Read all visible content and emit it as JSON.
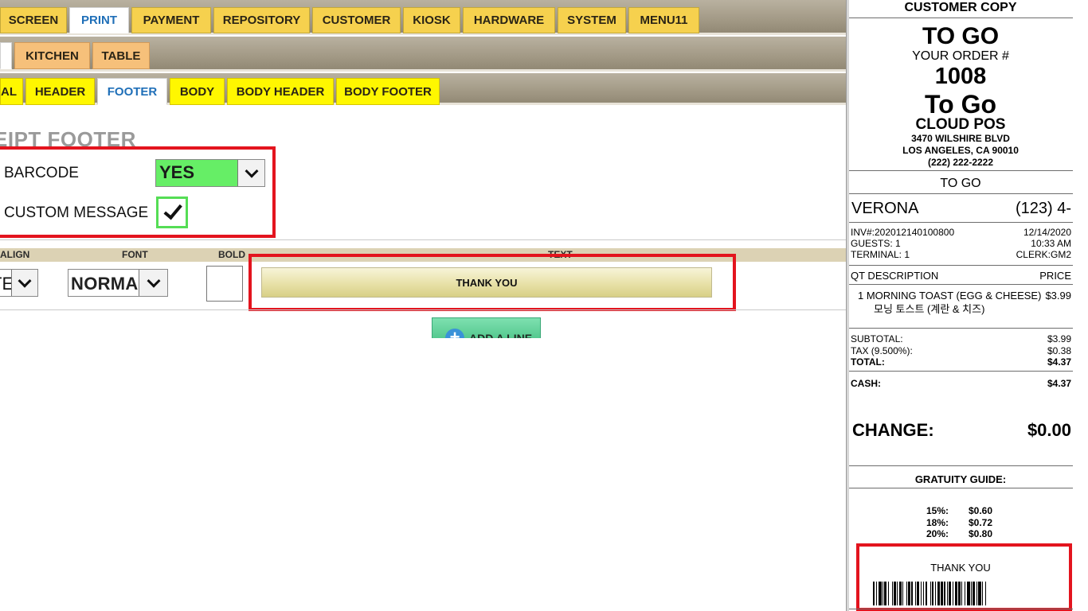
{
  "top_tabs": [
    {
      "label": "SCREEN",
      "active": false
    },
    {
      "label": "PRINT",
      "active": true
    },
    {
      "label": "PAYMENT",
      "active": false
    },
    {
      "label": "REPOSITORY",
      "active": false
    },
    {
      "label": "CUSTOMER",
      "active": false
    },
    {
      "label": "KIOSK",
      "active": false
    },
    {
      "label": "HARDWARE",
      "active": false
    },
    {
      "label": "SYSTEM",
      "active": false
    },
    {
      "label": "MENU11",
      "active": false
    }
  ],
  "print_tabs": [
    {
      "label": "",
      "active": true
    },
    {
      "label": "KITCHEN",
      "active": false
    },
    {
      "label": "TABLE",
      "active": false
    }
  ],
  "receipt_tabs": [
    {
      "label": "AL",
      "active": false
    },
    {
      "label": "HEADER",
      "active": false
    },
    {
      "label": "FOOTER",
      "active": true
    },
    {
      "label": "BODY",
      "active": false
    },
    {
      "label": "BODY HEADER",
      "active": false
    },
    {
      "label": "BODY FOOTER",
      "active": false
    }
  ],
  "section": {
    "title": "EIPT FOOTER",
    "barcode_label": "BARCODE",
    "barcode_value": "YES",
    "custom_message_label": "CUSTOM MESSAGE",
    "custom_message_checked": true
  },
  "line_editor": {
    "headers": {
      "align": "ALIGN",
      "font": "FONT",
      "bold": "BOLD",
      "text": "TEXT"
    },
    "align_value": "TE",
    "font_value": "NORMA",
    "bold_checked": false,
    "text_value": "THANK YOU",
    "add_line_label": "ADD A LINE"
  },
  "receipt": {
    "copy_label": "CUSTOMER COPY",
    "order_type": "TO GO",
    "order_label": "YOUR ORDER #",
    "order_number": "1008",
    "order_type_big": "To Go",
    "store_name": "CLOUD POS",
    "address1": "3470 WILSHIRE BLVD",
    "address2": "LOS ANGELES, CA 90010",
    "phone": "(222) 222-2222",
    "dining": "TO GO",
    "customer_name": "VERONA",
    "customer_phone": "(123) 4-",
    "invoice": "INV#:202012140100800",
    "date": "12/14/2020",
    "guests": "GUESTS: 1",
    "time": "10:33 AM",
    "terminal": "TERMINAL: 1",
    "clerk": "CLERK:GM2",
    "col_desc": "QT DESCRIPTION",
    "col_price": "PRICE",
    "item_line": "1 MORNING TOAST (EGG & CHEESE)",
    "item_price": "$3.99",
    "item_korean": "모닝 토스트 (계란 & 치즈)",
    "subtotal_label": "SUBTOTAL:",
    "subtotal": "$3.99",
    "tax_label": "TAX (9.500%):",
    "tax": "$0.38",
    "total_label": "TOTAL:",
    "total": "$4.37",
    "cash_label": "CASH:",
    "cash": "$4.37",
    "change_label": "CHANGE:",
    "change": "$0.00",
    "gratuity_title": "GRATUITY GUIDE:",
    "gratuity": [
      {
        "pct": "15%:",
        "amt": "$0.60"
      },
      {
        "pct": "18%:",
        "amt": "$0.72"
      },
      {
        "pct": "20%:",
        "amt": "$0.80"
      }
    ],
    "footer_message": "THANK YOU"
  },
  "colors": {
    "highlight_box": "#e3141e",
    "active_tab_text": "#1f6fb8",
    "yes_select_bg": "#66ee66"
  }
}
